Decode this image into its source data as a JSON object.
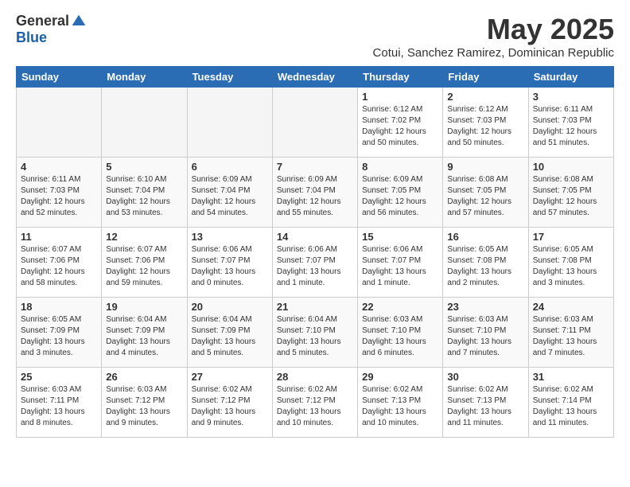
{
  "logo": {
    "general": "General",
    "blue": "Blue"
  },
  "title": "May 2025",
  "subtitle": "Cotui, Sanchez Ramirez, Dominican Republic",
  "days_of_week": [
    "Sunday",
    "Monday",
    "Tuesday",
    "Wednesday",
    "Thursday",
    "Friday",
    "Saturday"
  ],
  "weeks": [
    [
      {
        "day": "",
        "info": ""
      },
      {
        "day": "",
        "info": ""
      },
      {
        "day": "",
        "info": ""
      },
      {
        "day": "",
        "info": ""
      },
      {
        "day": "1",
        "info": "Sunrise: 6:12 AM\nSunset: 7:02 PM\nDaylight: 12 hours\nand 50 minutes."
      },
      {
        "day": "2",
        "info": "Sunrise: 6:12 AM\nSunset: 7:03 PM\nDaylight: 12 hours\nand 50 minutes."
      },
      {
        "day": "3",
        "info": "Sunrise: 6:11 AM\nSunset: 7:03 PM\nDaylight: 12 hours\nand 51 minutes."
      }
    ],
    [
      {
        "day": "4",
        "info": "Sunrise: 6:11 AM\nSunset: 7:03 PM\nDaylight: 12 hours\nand 52 minutes."
      },
      {
        "day": "5",
        "info": "Sunrise: 6:10 AM\nSunset: 7:04 PM\nDaylight: 12 hours\nand 53 minutes."
      },
      {
        "day": "6",
        "info": "Sunrise: 6:09 AM\nSunset: 7:04 PM\nDaylight: 12 hours\nand 54 minutes."
      },
      {
        "day": "7",
        "info": "Sunrise: 6:09 AM\nSunset: 7:04 PM\nDaylight: 12 hours\nand 55 minutes."
      },
      {
        "day": "8",
        "info": "Sunrise: 6:09 AM\nSunset: 7:05 PM\nDaylight: 12 hours\nand 56 minutes."
      },
      {
        "day": "9",
        "info": "Sunrise: 6:08 AM\nSunset: 7:05 PM\nDaylight: 12 hours\nand 57 minutes."
      },
      {
        "day": "10",
        "info": "Sunrise: 6:08 AM\nSunset: 7:05 PM\nDaylight: 12 hours\nand 57 minutes."
      }
    ],
    [
      {
        "day": "11",
        "info": "Sunrise: 6:07 AM\nSunset: 7:06 PM\nDaylight: 12 hours\nand 58 minutes."
      },
      {
        "day": "12",
        "info": "Sunrise: 6:07 AM\nSunset: 7:06 PM\nDaylight: 12 hours\nand 59 minutes."
      },
      {
        "day": "13",
        "info": "Sunrise: 6:06 AM\nSunset: 7:07 PM\nDaylight: 13 hours\nand 0 minutes."
      },
      {
        "day": "14",
        "info": "Sunrise: 6:06 AM\nSunset: 7:07 PM\nDaylight: 13 hours\nand 1 minute."
      },
      {
        "day": "15",
        "info": "Sunrise: 6:06 AM\nSunset: 7:07 PM\nDaylight: 13 hours\nand 1 minute."
      },
      {
        "day": "16",
        "info": "Sunrise: 6:05 AM\nSunset: 7:08 PM\nDaylight: 13 hours\nand 2 minutes."
      },
      {
        "day": "17",
        "info": "Sunrise: 6:05 AM\nSunset: 7:08 PM\nDaylight: 13 hours\nand 3 minutes."
      }
    ],
    [
      {
        "day": "18",
        "info": "Sunrise: 6:05 AM\nSunset: 7:09 PM\nDaylight: 13 hours\nand 3 minutes."
      },
      {
        "day": "19",
        "info": "Sunrise: 6:04 AM\nSunset: 7:09 PM\nDaylight: 13 hours\nand 4 minutes."
      },
      {
        "day": "20",
        "info": "Sunrise: 6:04 AM\nSunset: 7:09 PM\nDaylight: 13 hours\nand 5 minutes."
      },
      {
        "day": "21",
        "info": "Sunrise: 6:04 AM\nSunset: 7:10 PM\nDaylight: 13 hours\nand 5 minutes."
      },
      {
        "day": "22",
        "info": "Sunrise: 6:03 AM\nSunset: 7:10 PM\nDaylight: 13 hours\nand 6 minutes."
      },
      {
        "day": "23",
        "info": "Sunrise: 6:03 AM\nSunset: 7:10 PM\nDaylight: 13 hours\nand 7 minutes."
      },
      {
        "day": "24",
        "info": "Sunrise: 6:03 AM\nSunset: 7:11 PM\nDaylight: 13 hours\nand 7 minutes."
      }
    ],
    [
      {
        "day": "25",
        "info": "Sunrise: 6:03 AM\nSunset: 7:11 PM\nDaylight: 13 hours\nand 8 minutes."
      },
      {
        "day": "26",
        "info": "Sunrise: 6:03 AM\nSunset: 7:12 PM\nDaylight: 13 hours\nand 9 minutes."
      },
      {
        "day": "27",
        "info": "Sunrise: 6:02 AM\nSunset: 7:12 PM\nDaylight: 13 hours\nand 9 minutes."
      },
      {
        "day": "28",
        "info": "Sunrise: 6:02 AM\nSunset: 7:12 PM\nDaylight: 13 hours\nand 10 minutes."
      },
      {
        "day": "29",
        "info": "Sunrise: 6:02 AM\nSunset: 7:13 PM\nDaylight: 13 hours\nand 10 minutes."
      },
      {
        "day": "30",
        "info": "Sunrise: 6:02 AM\nSunset: 7:13 PM\nDaylight: 13 hours\nand 11 minutes."
      },
      {
        "day": "31",
        "info": "Sunrise: 6:02 AM\nSunset: 7:14 PM\nDaylight: 13 hours\nand 11 minutes."
      }
    ]
  ]
}
